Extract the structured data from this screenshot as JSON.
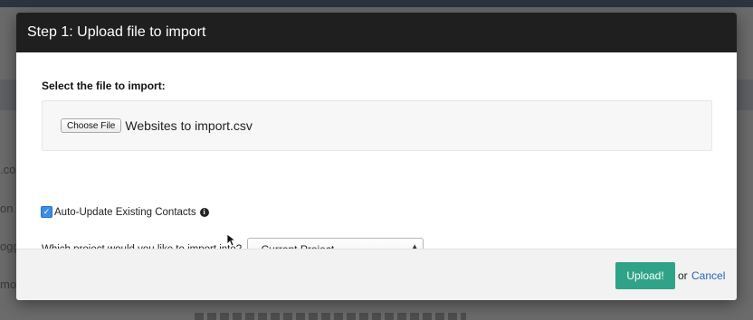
{
  "modal": {
    "title": "Step 1: Upload file to import",
    "file_section_label": "Select the file to import:",
    "choose_file_label": "Choose File",
    "file_name": "Websites to import.csv",
    "auto_update_label": "Auto-Update Existing Contacts",
    "auto_update_checked": true,
    "project_label": "Which project would you like to import into?",
    "project_select_value": "- Current Project -",
    "upload_label": "Upload!",
    "or_text": "or",
    "cancel_label": "Cancel"
  },
  "background": {
    "fragments": [
      ".co",
      "on",
      "ogg",
      "mor"
    ]
  },
  "colors": {
    "header_bg": "#1f1f1f",
    "upload_button": "#2fa387",
    "cancel_link": "#2a62b8",
    "checkbox": "#3b8ee6"
  },
  "icons": {
    "info": "info-circle-icon",
    "checkbox": "checkmark-icon",
    "select_arrows": "sort-arrows-icon"
  }
}
